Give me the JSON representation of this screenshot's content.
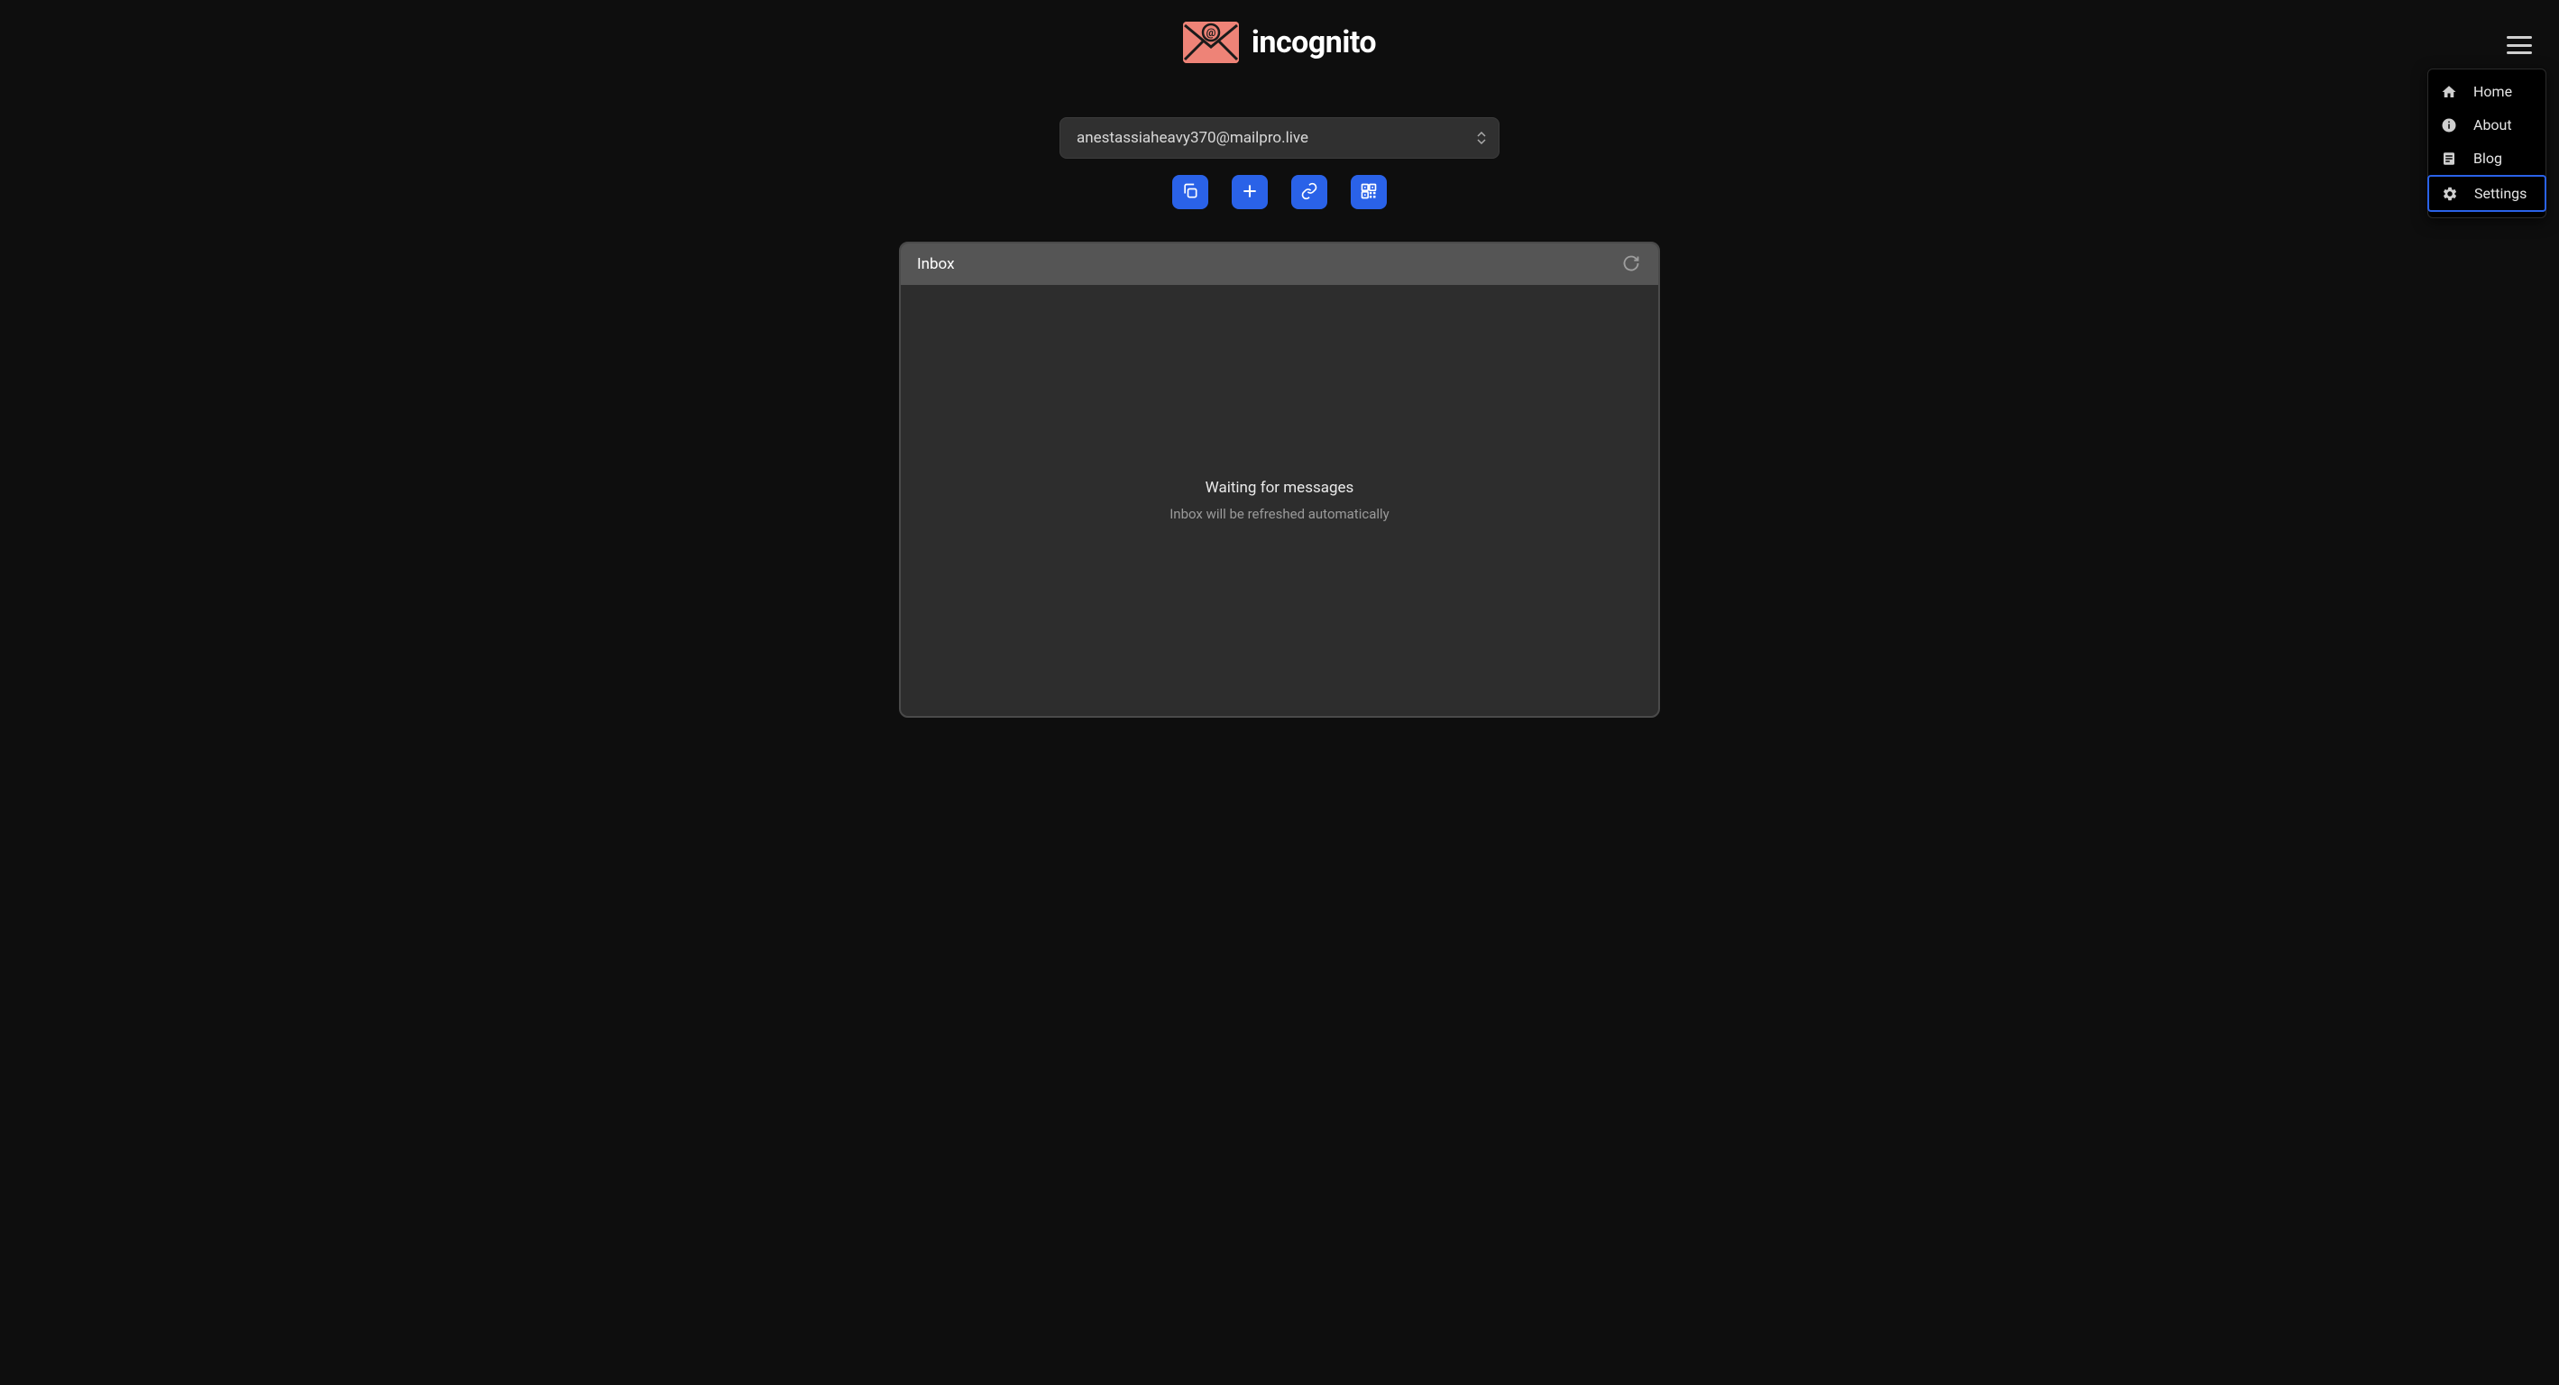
{
  "brand": {
    "name": "incognito"
  },
  "email": {
    "selected": "anestassiaheavy370@mailpro.live"
  },
  "actions": {
    "copy": "Copy",
    "add": "New",
    "link": "Link",
    "qr": "QR"
  },
  "inbox": {
    "title": "Inbox",
    "waiting_title": "Waiting for messages",
    "waiting_sub": "Inbox will be refreshed automatically"
  },
  "menu": {
    "items": [
      {
        "label": "Home",
        "icon": "home",
        "active": false
      },
      {
        "label": "About",
        "icon": "info",
        "active": false
      },
      {
        "label": "Blog",
        "icon": "article",
        "active": false
      },
      {
        "label": "Settings",
        "icon": "gear",
        "active": true
      }
    ]
  }
}
